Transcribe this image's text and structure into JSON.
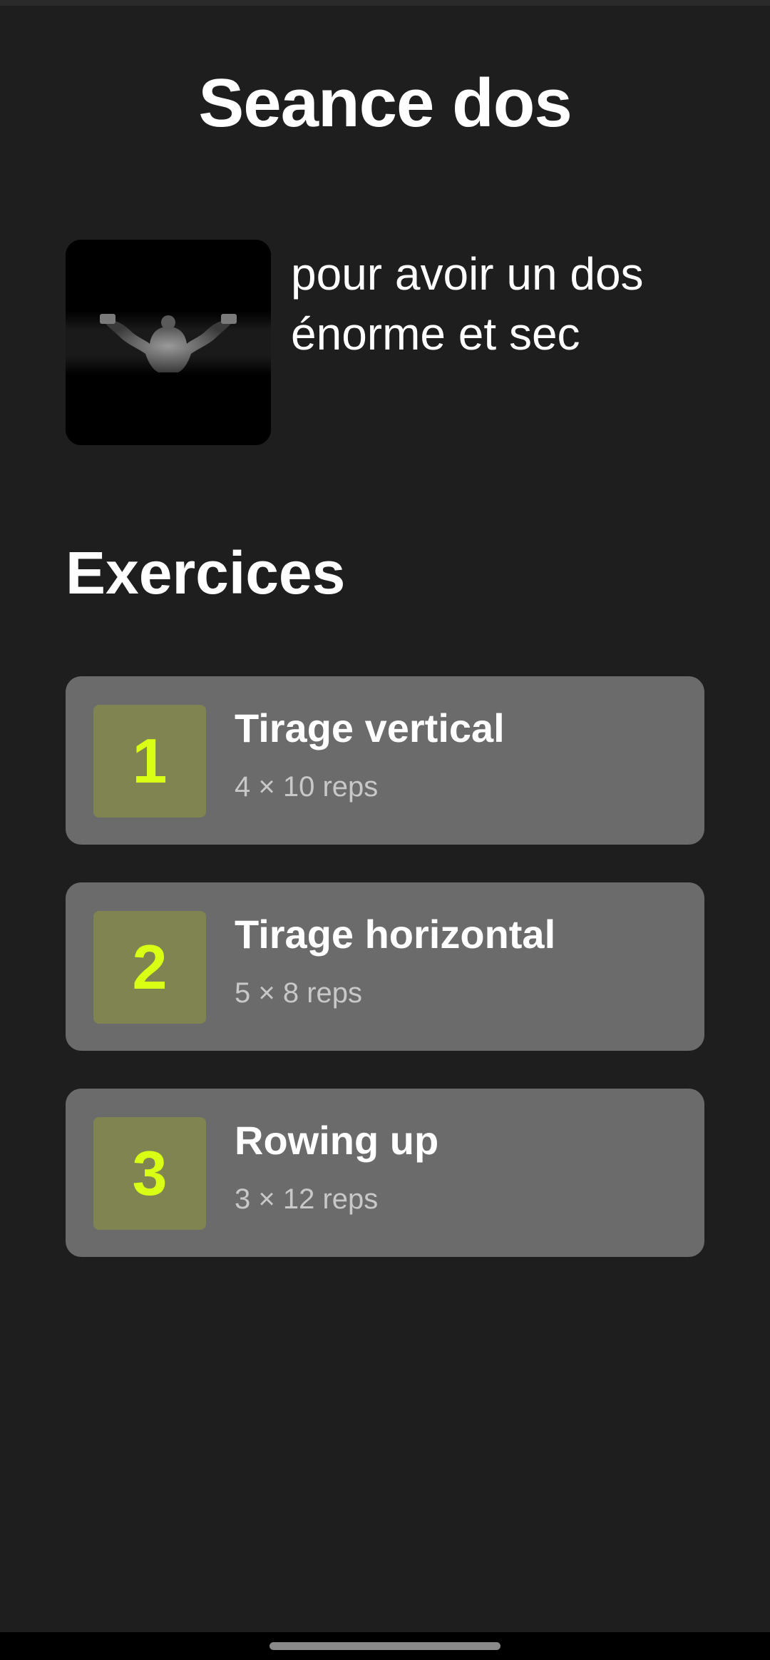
{
  "page": {
    "title": "Seance dos"
  },
  "hero": {
    "image_icon": "back-workout-photo",
    "description": "pour avoir un dos énorme et sec"
  },
  "section": {
    "title": "Exercices"
  },
  "exercises": [
    {
      "number": "1",
      "name": "Tirage vertical",
      "reps": "4 × 10 reps"
    },
    {
      "number": "2",
      "name": "Tirage horizontal",
      "reps": "5 × 8 reps"
    },
    {
      "number": "3",
      "name": "Rowing up",
      "reps": "3 × 12 reps"
    }
  ],
  "colors": {
    "background": "#1e1e1e",
    "card": "#6b6b6b",
    "badge": "#7f8450",
    "accent": "#d9ff14",
    "reps_text": "#c8c8c8"
  }
}
